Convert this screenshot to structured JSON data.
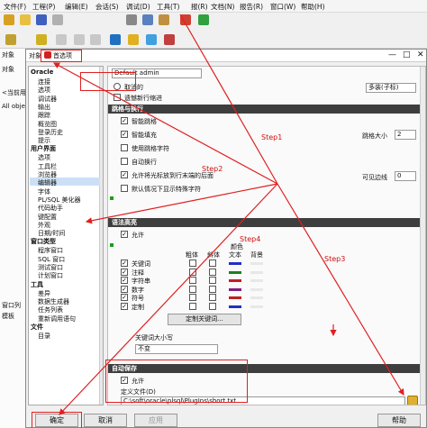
{
  "menubar": {
    "items": [
      "文件(F)",
      "工程(P)",
      "编辑(E)",
      "会话(S)",
      "调试(D)",
      "工具(T)",
      "报(R)",
      "文档(N)",
      "报告(R)",
      "窗口(W)",
      "帮助(H)"
    ]
  },
  "leftpane": {
    "tab_objects": "对象",
    "tab_objects2": "对象",
    "current_user": "<当前用",
    "all_objects": "All objec",
    "windows_list": "窗口列",
    "module": "模板"
  },
  "dialog": {
    "tab_objects": "对象",
    "title": "首选项",
    "minimize": "—",
    "maximize": "□",
    "close": "✕"
  },
  "categories": {
    "groups": [
      {
        "head": "Oracle",
        "items": [
          "连接",
          "选项",
          "调试器",
          "输出",
          "跟踪",
          "概览图",
          "登录历史",
          "提示"
        ]
      },
      {
        "head": "用户界面",
        "items": [
          "选项",
          "工具栏",
          "浏览器",
          "编辑器",
          "字体",
          "PL/SQL 美化器",
          "代码助手",
          "键配置",
          "外观",
          "日期/时间"
        ]
      },
      {
        "head": "窗口类型",
        "items": [
          "程序窗口",
          "SQL 窗口",
          "测试窗口",
          "计划窗口"
        ]
      },
      {
        "head": "工具",
        "items": [
          "差异",
          "数据生成器",
          "任务列表",
          "重新调用语句"
        ]
      },
      {
        "head": "文件",
        "items": [
          "目录"
        ]
      }
    ],
    "selected": "编辑器"
  },
  "prefs": {
    "top_select": "Default admin",
    "radio_label": "取消的",
    "top_right_select": "多装(子标)",
    "checkbox_top": "遗憾新行缩进",
    "sections": {
      "indent": "跳格与换行",
      "syntax": "语法高亮",
      "autosave": "自动保存"
    },
    "indent_items": [
      {
        "label": "智能跳格",
        "checked": true
      },
      {
        "label": "智能填充",
        "checked": true
      },
      {
        "label": "使用跳格字符",
        "checked": false
      },
      {
        "label": "自动换行",
        "checked": false
      },
      {
        "label": "允许将光标放到行末端的后面",
        "checked": true
      },
      {
        "label": "默认情况下显示特殊字符",
        "checked": false
      }
    ],
    "tab_size_label": "跳格大小",
    "tab_size_value": "2",
    "visible_margin_label": "可见边线",
    "visible_margin_value": "0",
    "syntax_allow": "允许",
    "col_headers": {
      "bold": "粗体",
      "italic": "斜体",
      "text": "文本",
      "bg": "背景",
      "color": "颜色"
    },
    "syntax_items": [
      "关键词",
      "注释",
      "字符串",
      "数字",
      "符号",
      "定制"
    ],
    "custom_keywords_btn": "定制关键词...",
    "keyword_case_label": "关键词大小写",
    "keyword_case_value": "不变",
    "autosave_allow": "允许",
    "definition_file_label": "定义文件(D)",
    "definition_file_value": "C:\\soft\\oracle\\plsql\\PlugIns\\short.txt"
  },
  "buttons": {
    "ok": "确定",
    "cancel": "取消",
    "apply": "应用",
    "help": "帮助"
  },
  "annotations": {
    "step1": "Step1",
    "step2": "Step2",
    "step3": "Step3",
    "step4": "Step4"
  },
  "colors": {
    "annotation_red": "#e02020",
    "section_header": "#3e3e3e",
    "selection": "#cce0f5"
  }
}
